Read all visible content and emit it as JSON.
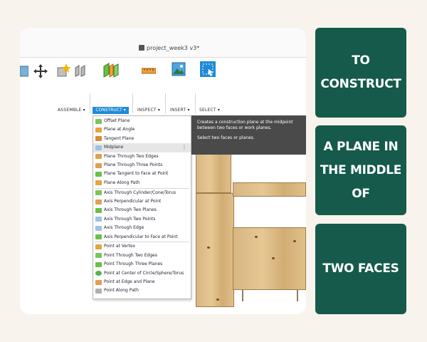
{
  "window": {
    "title": "project_week3 v3*"
  },
  "toolbar": {
    "groups": [
      "ASSEMBLE ▾",
      "CONSTRUCT ▾",
      "INSPECT ▾",
      "INSERT ▾",
      "SELECT ▾"
    ],
    "active_group": "CONSTRUCT"
  },
  "construct_menu": {
    "items": [
      "Offset Plane",
      "Plane at Angle",
      "Tangent Plane",
      "Midplane",
      "Plane Through Two Edges",
      "Plane Through Three Points",
      "Plane Tangent to Face at Point",
      "Plane Along Path",
      "Axis Through Cylinder/Cone/Torus",
      "Axis Perpendicular at Point",
      "Axis Through Two Planes",
      "Axis Through Two Points",
      "Axis Through Edge",
      "Axis Perpendicular to Face at Point",
      "Point at Vertex",
      "Point Through Two Edges",
      "Point Through Three Planes",
      "Point at Center of Circle/Sphere/Torus",
      "Point at Edge and Plane",
      "Point Along Path"
    ],
    "highlighted": "Midplane",
    "more_icon": "⋮"
  },
  "tooltip": {
    "line1": "Creates a construction plane at the midpoint between two faces or work planes.",
    "line2": "Select two faces or planes."
  },
  "captions": {
    "first": "TO CONSTRUCT",
    "second_a": "A PLANE IN",
    "second_b": "THE MIDDLE OF",
    "third": "TWO FACES"
  },
  "colors": {
    "caption_bg": "#155a4a",
    "page_bg": "#f8f3ec",
    "construct_blue": "#1f8bd6",
    "tooltip_bg": "#4a4a4a"
  },
  "icons": {
    "move": "move-arrows-icon",
    "inspect": "measure-ruler-icon",
    "insert": "insert-image-icon",
    "select": "select-window-icon"
  }
}
